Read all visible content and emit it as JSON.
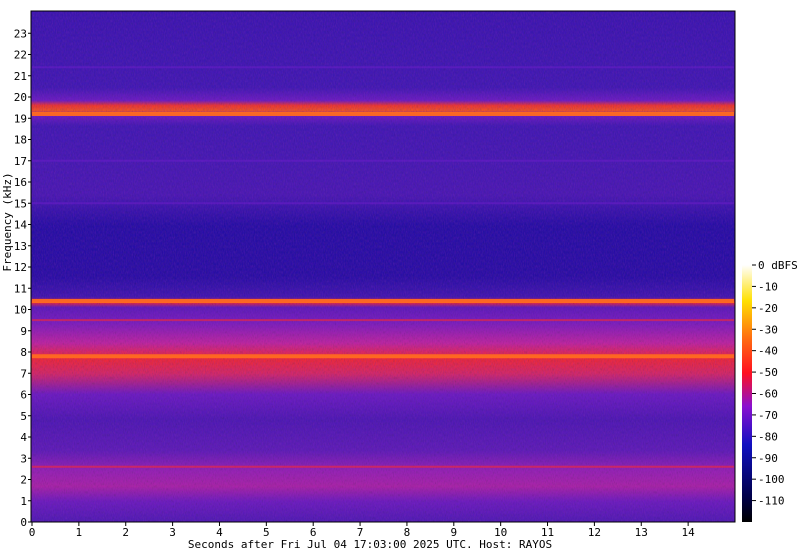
{
  "chart_data": {
    "type": "heatmap",
    "xlabel": "Seconds after Fri Jul 04 17:03:00 2025 UTC. Host: RAYOS",
    "ylabel": "Frequency (kHz)",
    "xlim": [
      0,
      15
    ],
    "ylim": [
      0,
      24
    ],
    "x_ticks": [
      0,
      1,
      2,
      3,
      4,
      5,
      6,
      7,
      8,
      9,
      10,
      11,
      12,
      13,
      14
    ],
    "y_ticks": [
      0,
      1,
      2,
      3,
      4,
      5,
      6,
      7,
      8,
      9,
      10,
      11,
      12,
      13,
      14,
      15,
      16,
      17,
      18,
      19,
      20,
      21,
      22,
      23
    ],
    "colorbar": {
      "label": "dBFS",
      "range": [
        -120,
        0
      ],
      "ticks": [
        {
          "value": 0,
          "label": "0 dBFS"
        },
        {
          "value": -10,
          "label": "-10"
        },
        {
          "value": -20,
          "label": "-20"
        },
        {
          "value": -30,
          "label": "-30"
        },
        {
          "value": -40,
          "label": "-40"
        },
        {
          "value": -50,
          "label": "-50"
        },
        {
          "value": -60,
          "label": "-60"
        },
        {
          "value": -70,
          "label": "-70"
        },
        {
          "value": -80,
          "label": "-80"
        },
        {
          "value": -90,
          "label": "-90"
        },
        {
          "value": -100,
          "label": "-100"
        },
        {
          "value": -110,
          "label": "-110"
        }
      ]
    },
    "colors": {
      "background": "#2a0a9a",
      "deep": "#1a08a8",
      "mid": "#6a1ec8",
      "hot": "#ff2a2a",
      "warm": "#ff6a20"
    },
    "bands": [
      {
        "freq_khz": 19.2,
        "level_dbfs": -48
      },
      {
        "freq_khz": 10.4,
        "level_dbfs": -52
      },
      {
        "freq_khz": 9.5,
        "level_dbfs": -62
      },
      {
        "freq_khz": 7.8,
        "level_dbfs": -56
      },
      {
        "freq_khz": 2.6,
        "level_dbfs": -62
      },
      {
        "freq_khz": 21.4,
        "level_dbfs": -74
      },
      {
        "freq_khz": 17.0,
        "level_dbfs": -74
      },
      {
        "freq_khz": 15.0,
        "level_dbfs": -75
      }
    ]
  }
}
